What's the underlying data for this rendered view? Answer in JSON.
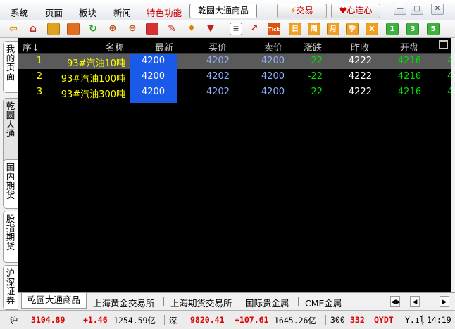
{
  "menu": {
    "items": [
      "系统",
      "页面",
      "板块",
      "新闻"
    ],
    "special": "特色功能",
    "market_tab": "乾圆大通商品",
    "trade_label": "交易",
    "xinlian_label": "心连心",
    "min": "—",
    "max": "□",
    "close": "✕"
  },
  "toolbar": {
    "chars": [
      "日",
      "周",
      "月",
      "季",
      "X",
      "1",
      "3",
      "5"
    ],
    "tick": "Tick"
  },
  "sidetabs": [
    "我的页面",
    "乾圆大通",
    "国内期货",
    "股指期货",
    "沪深证券"
  ],
  "grid": {
    "headers": {
      "idx": "序↓",
      "name": "名称",
      "last": "最新",
      "bid": "买价",
      "ask": "卖价",
      "chg": "涨跌",
      "pre": "昨收",
      "open": "开盘"
    },
    "rows": [
      {
        "idx": "1",
        "name": "93#汽油10吨",
        "last": "4200",
        "bid": "4202",
        "ask": "4200",
        "chg": "-22",
        "pre": "4222",
        "open": "4216",
        "more": "4"
      },
      {
        "idx": "2",
        "name": "93#汽油100吨",
        "last": "4200",
        "bid": "4202",
        "ask": "4200",
        "chg": "-22",
        "pre": "4222",
        "open": "4216",
        "more": "4"
      },
      {
        "idx": "3",
        "name": "93#汽油300吨",
        "last": "4200",
        "bid": "4202",
        "ask": "4200",
        "chg": "-22",
        "pre": "4222",
        "open": "4216",
        "more": "4"
      }
    ]
  },
  "exchanges": [
    "乾圆大通商品",
    "上海黄金交易所",
    "上海期货交易所",
    "国际贵金属",
    "CME金属"
  ],
  "status": {
    "sh_label": "沪",
    "sh_index": "3104.89",
    "sh_chg": "+1.46",
    "sh_amt": "1254.59亿",
    "sz_label": "深",
    "sz_index": "9820.41",
    "sz_chg": "+107.61",
    "sz_amt": "1645.26亿",
    "count": "300",
    "count2": "332",
    "qydt": "QYDT",
    "time": "14:19"
  }
}
